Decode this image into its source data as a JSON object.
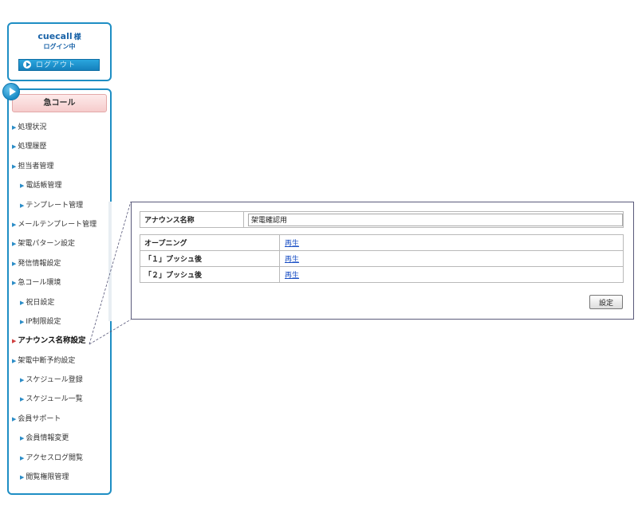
{
  "login": {
    "username": "cuecall",
    "honorific": "様",
    "status": "ログイン中",
    "logout_label": "ログアウト"
  },
  "menu": {
    "header": "急コール",
    "items": [
      {
        "label": "処理状況",
        "level": 1
      },
      {
        "label": "処理履歴",
        "level": 1
      },
      {
        "label": "担当者管理",
        "level": 1
      },
      {
        "label": "電話帳管理",
        "level": 2
      },
      {
        "label": "テンプレート管理",
        "level": 2
      },
      {
        "label": "メールテンプレート管理",
        "level": 1
      },
      {
        "label": "架電パターン設定",
        "level": 1
      },
      {
        "label": "発信情報設定",
        "level": 1
      },
      {
        "label": "急コール環境",
        "level": 1
      },
      {
        "label": "祝日設定",
        "level": 2
      },
      {
        "label": "IP制限設定",
        "level": 2
      },
      {
        "label": "アナウンス名称設定",
        "level": 1,
        "active": true
      },
      {
        "label": "架電中断予約設定",
        "level": 1
      },
      {
        "label": "スケジュール登録",
        "level": 2
      },
      {
        "label": "スケジュール一覧",
        "level": 2
      },
      {
        "label": "会員サポート",
        "level": 1
      },
      {
        "label": "会員情報変更",
        "level": 2
      },
      {
        "label": "アクセスログ閲覧",
        "level": 2
      },
      {
        "label": "閲覧権限管理",
        "level": 2
      }
    ]
  },
  "panel": {
    "name_label": "アナウンス名称",
    "name_value": "架電確認用",
    "rows": [
      {
        "label": "オープニング",
        "link": "再生"
      },
      {
        "label": "「１」プッシュ後",
        "link": "再生"
      },
      {
        "label": "「２」プッシュ後",
        "link": "再生"
      }
    ],
    "submit_label": "設定"
  },
  "colors": {
    "frame_blue": "#1e8ec4",
    "header_pink": "#f6cccc",
    "link_blue": "#1a4fc4"
  }
}
